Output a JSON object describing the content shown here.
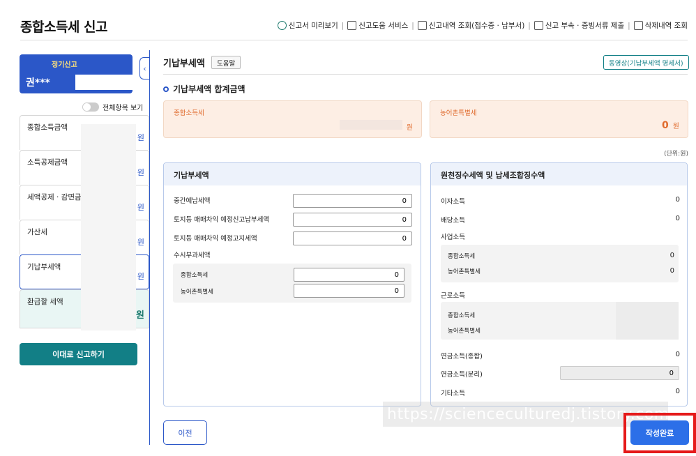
{
  "page": {
    "title": "종합소득세 신고",
    "top_menu": [
      {
        "icon": "preview-icon",
        "label": "신고서 미리보기"
      },
      {
        "icon": "monitor-help-icon",
        "label": "신고도움 서비스"
      },
      {
        "icon": "document-search-icon",
        "label": "신고내역 조회(접수증 · 납부서)"
      },
      {
        "icon": "attach-document-icon",
        "label": "신고 부속 · 증빙서류 제출"
      },
      {
        "icon": "trash-icon",
        "label": "삭제내역 조회"
      }
    ]
  },
  "sidebar": {
    "report_type": "정기신고",
    "user_name": "권***",
    "show_all_label": "전체항목 보기",
    "items": [
      {
        "label": "종합소득금액",
        "amount_unit": "원"
      },
      {
        "label": "소득공제금액",
        "amount_unit": "원"
      },
      {
        "label": "세액공제 · 감면금",
        "amount_unit": "원"
      },
      {
        "label": "가산세",
        "amount_unit": "원"
      },
      {
        "label": "기납부세액",
        "amount_unit": "원"
      },
      {
        "label": "환급할 세액",
        "amount_unit": "원"
      }
    ],
    "submit_label": "이대로 신고하기"
  },
  "main": {
    "title": "기납부세액",
    "help_label": "도움말",
    "video_label": "동영상(기납부세액 명세서)",
    "summary_title": "기납부세액 합계금액",
    "summary": [
      {
        "label": "종합소득세",
        "value": "",
        "unit": "원"
      },
      {
        "label": "농어촌특별세",
        "value": "0",
        "unit": "원"
      }
    ],
    "unit_note": "(단위:원)",
    "prepaid": {
      "header": "기납부세액",
      "rows": [
        {
          "label": "중간예납세액",
          "value": "0"
        },
        {
          "label": "토지등 매매차익 예정신고납부세액",
          "value": "0"
        },
        {
          "label": "토지등 매매차익 예정고지세액",
          "value": "0"
        }
      ],
      "occasional_label": "수시부과세액",
      "occasional": [
        {
          "label": "종합소득세",
          "value": "0"
        },
        {
          "label": "농어촌특별세",
          "value": "0"
        }
      ]
    },
    "withholding": {
      "header": "원천징수세액 및 납세조합징수액",
      "interest_label": "이자소득",
      "interest_value": "0",
      "dividend_label": "배당소득",
      "dividend_value": "0",
      "business_label": "사업소득",
      "business_sub": [
        {
          "label": "종합소득세",
          "value": "0"
        },
        {
          "label": "농어촌특별세",
          "value": "0"
        }
      ],
      "earned_label": "근로소득",
      "earned_sub": [
        {
          "label": "종합소득세"
        },
        {
          "label": "농어촌특별세"
        }
      ],
      "pension_combined_label": "연금소득(종합)",
      "pension_combined_value": "0",
      "pension_separate_label": "연금소득(분리)",
      "pension_separate_value": "0",
      "other_label": "기타소득",
      "other_value": "0"
    },
    "prev_label": "이전",
    "complete_label": "작성완료"
  },
  "watermark": "https://scienceculturedj.tistory.com",
  "colors": {
    "primary": "#2b57c8",
    "teal": "#127f86",
    "orange": "#e06b2d",
    "highlight": "#e51a1a"
  }
}
